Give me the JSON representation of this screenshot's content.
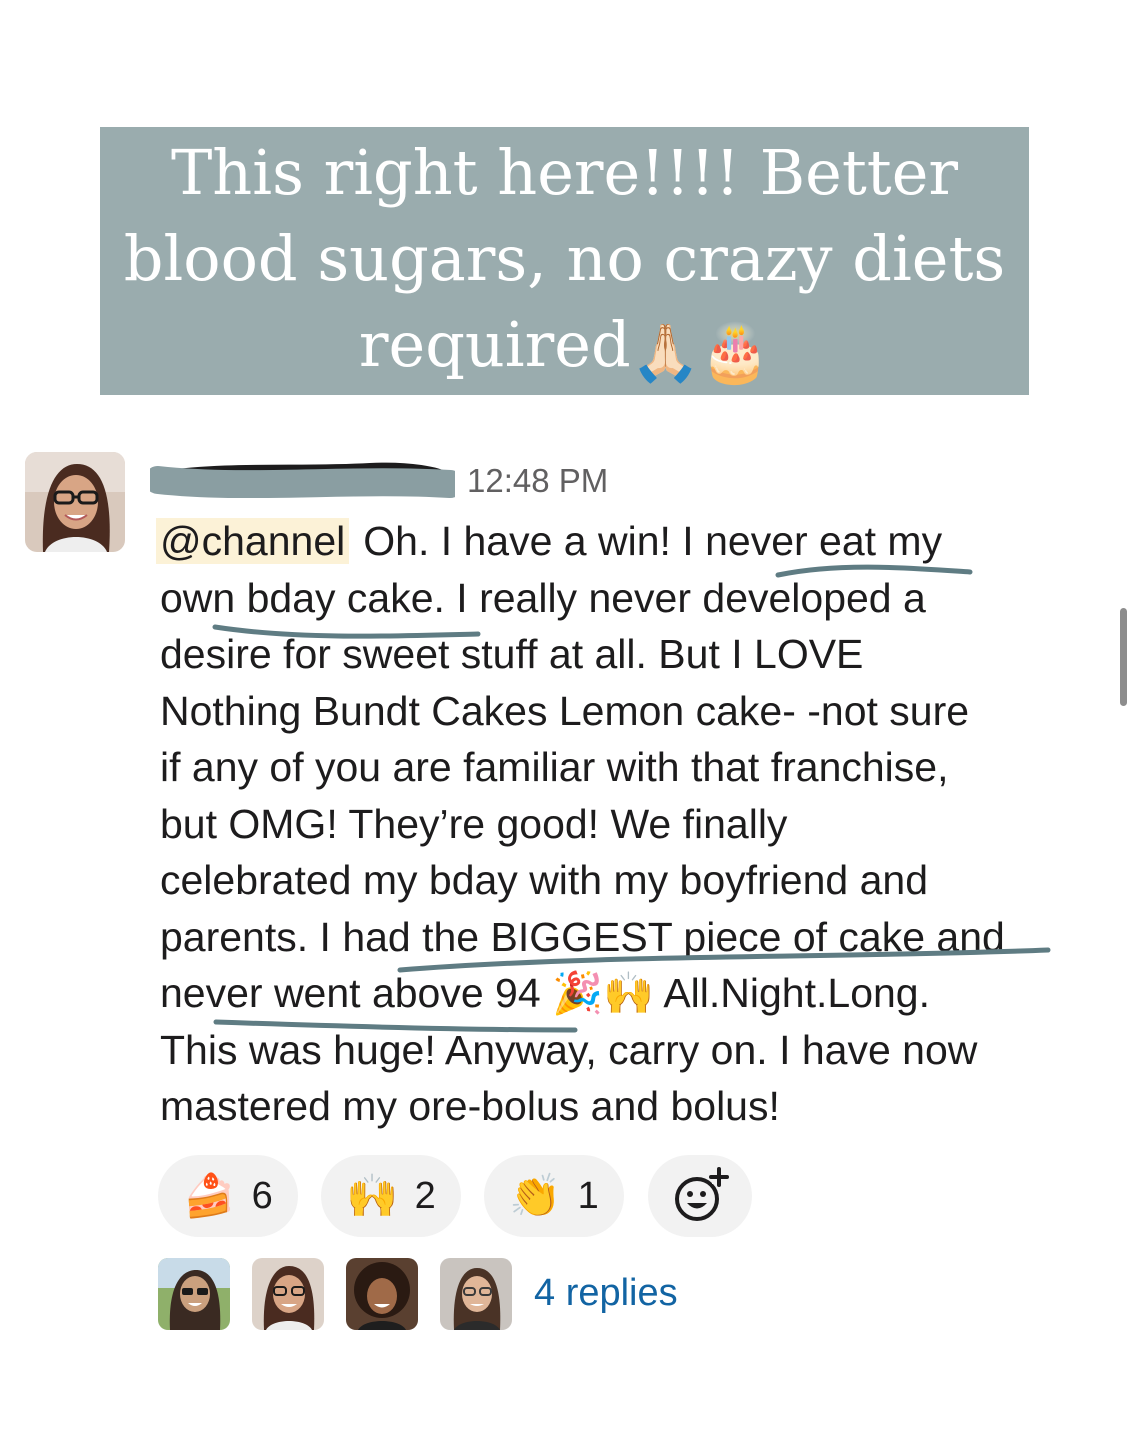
{
  "banner": {
    "text_line1": "This right here!!!! Better",
    "text_line2": "blood sugars, no crazy diets",
    "text_line3": "required",
    "emoji_1": "🙏🏻",
    "emoji_2": "🎂"
  },
  "message": {
    "timestamp": "12:48 PM",
    "mention": "@channel",
    "line1_rest": "Oh. I have a win! I never eat my",
    "line2": "own bday cake. I really never developed a",
    "line3": "desire for sweet stuff at all. But I LOVE",
    "line4": "Nothing Bundt Cakes Lemon cake- -not sure",
    "line5": "if any of you are familiar with that franchise,",
    "line6": "but OMG! They’re good! We finally",
    "line7": "celebrated my bday with my boyfriend and",
    "line8": "parents. I had the BIGGEST piece of cake and",
    "line9_a": "never went above 94",
    "line9_emoji_1": "🎉",
    "line9_emoji_2": "🙌",
    "line9_b": "All.Night.Long.",
    "line10": "This was huge! Anyway, carry on. I have now",
    "line11": "mastered my ore-bolus and bolus!"
  },
  "reactions": [
    {
      "emoji": "🍰",
      "icon": "cake-slice-icon",
      "count": "6"
    },
    {
      "emoji": "🙌",
      "icon": "raised-hands-icon",
      "count": "2"
    },
    {
      "emoji": "👏",
      "icon": "clapping-hands-icon",
      "count": "1"
    }
  ],
  "add_reaction_icon": "add-reaction-icon",
  "thread": {
    "replies_label": "4 replies"
  },
  "colors": {
    "banner_bg": "#9aacae",
    "mention_bg": "#fcf2d7",
    "link": "#1264a3",
    "timestamp": "#616061",
    "underline": "#5f7c83"
  }
}
